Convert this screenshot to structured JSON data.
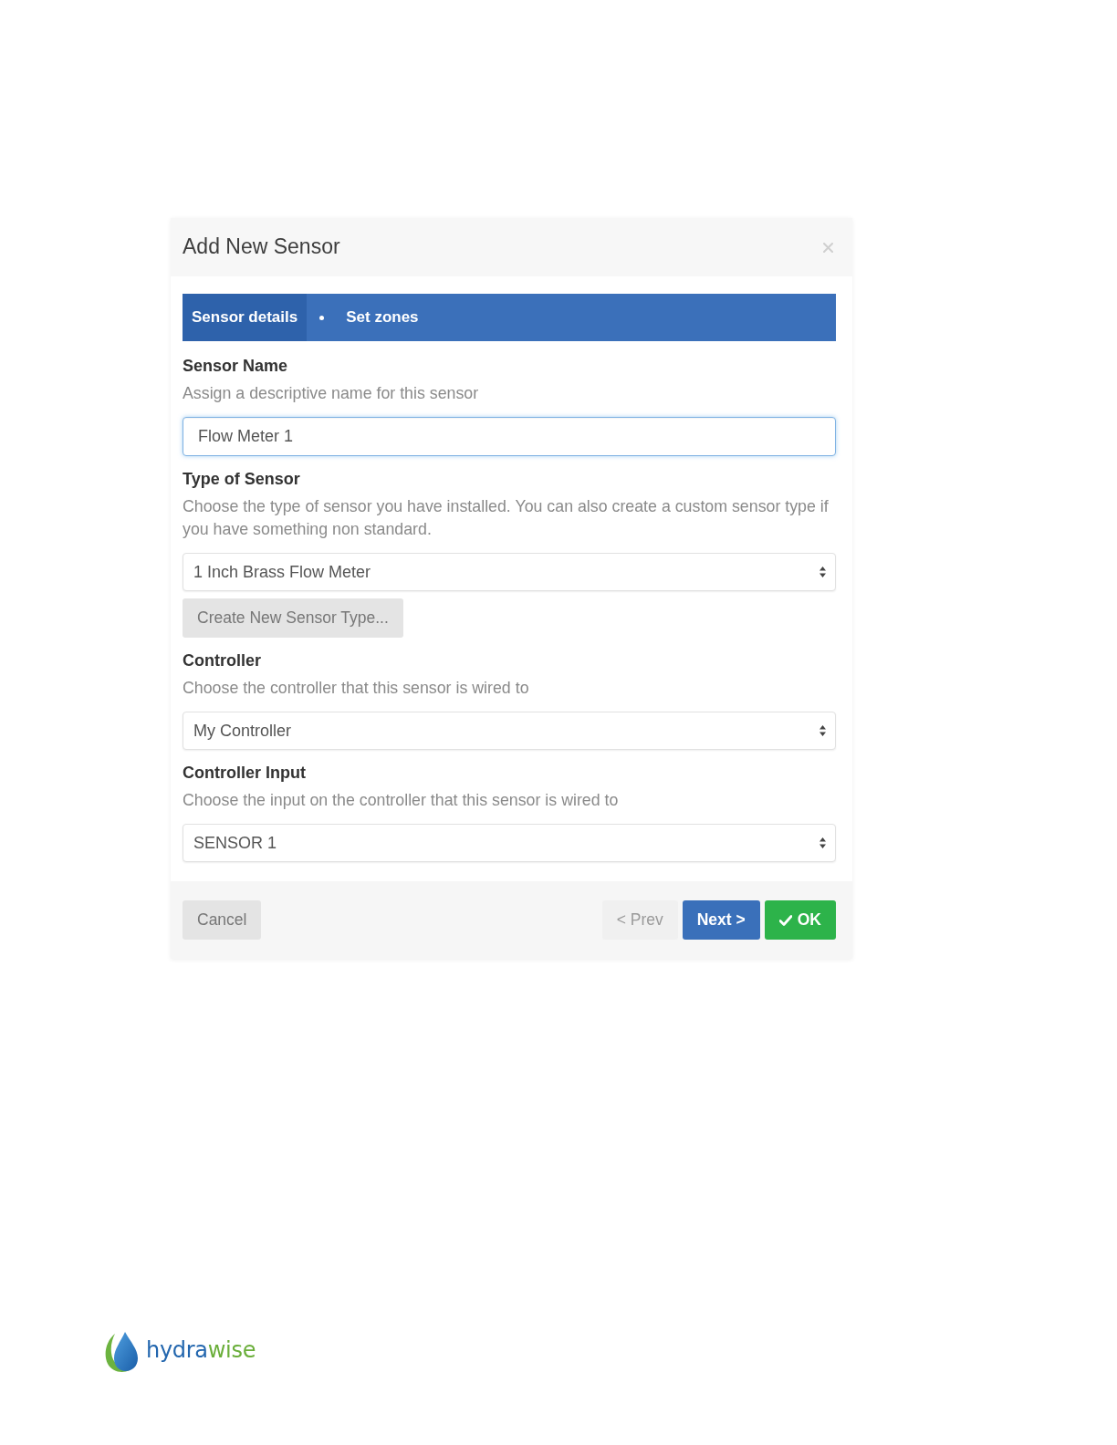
{
  "dialog": {
    "title": "Add New Sensor"
  },
  "steps": [
    {
      "label": "Sensor details",
      "selected": true
    },
    {
      "label": "Set zones",
      "selected": false
    }
  ],
  "fields": [
    {
      "kind": "text",
      "heading": "Sensor Name",
      "help": "Assign a descriptive name for this sensor",
      "value": "Flow Meter 1",
      "focused": true
    },
    {
      "kind": "select",
      "heading": "Type of Sensor",
      "help": "Choose the type of sensor you have installed. You can also create a custom sensor type if you have something non standard.",
      "value": "1 Inch Brass Flow Meter",
      "focused": false,
      "action": "Create New Sensor Type..."
    },
    {
      "kind": "select",
      "heading": "Controller",
      "help": "Choose the controller that this sensor is wired to",
      "value": "My Controller",
      "focused": false
    },
    {
      "kind": "select",
      "heading": "Controller Input",
      "help": "Choose the input on the controller that this sensor is wired to",
      "value": "SENSOR 1",
      "focused": false
    }
  ],
  "footer": {
    "left": [
      {
        "label": "Cancel",
        "kind": "default",
        "disabled": false
      }
    ],
    "right": [
      {
        "label": "< Prev",
        "kind": "default",
        "disabled": true
      },
      {
        "label": "Next >",
        "kind": "primary",
        "disabled": false
      },
      {
        "label": "OK",
        "kind": "success",
        "disabled": false
      }
    ]
  },
  "logo": {
    "parts": [
      {
        "text": "hydra",
        "color": "#2266ae"
      },
      {
        "text": "wise",
        "color": "#6aae3a"
      }
    ]
  }
}
